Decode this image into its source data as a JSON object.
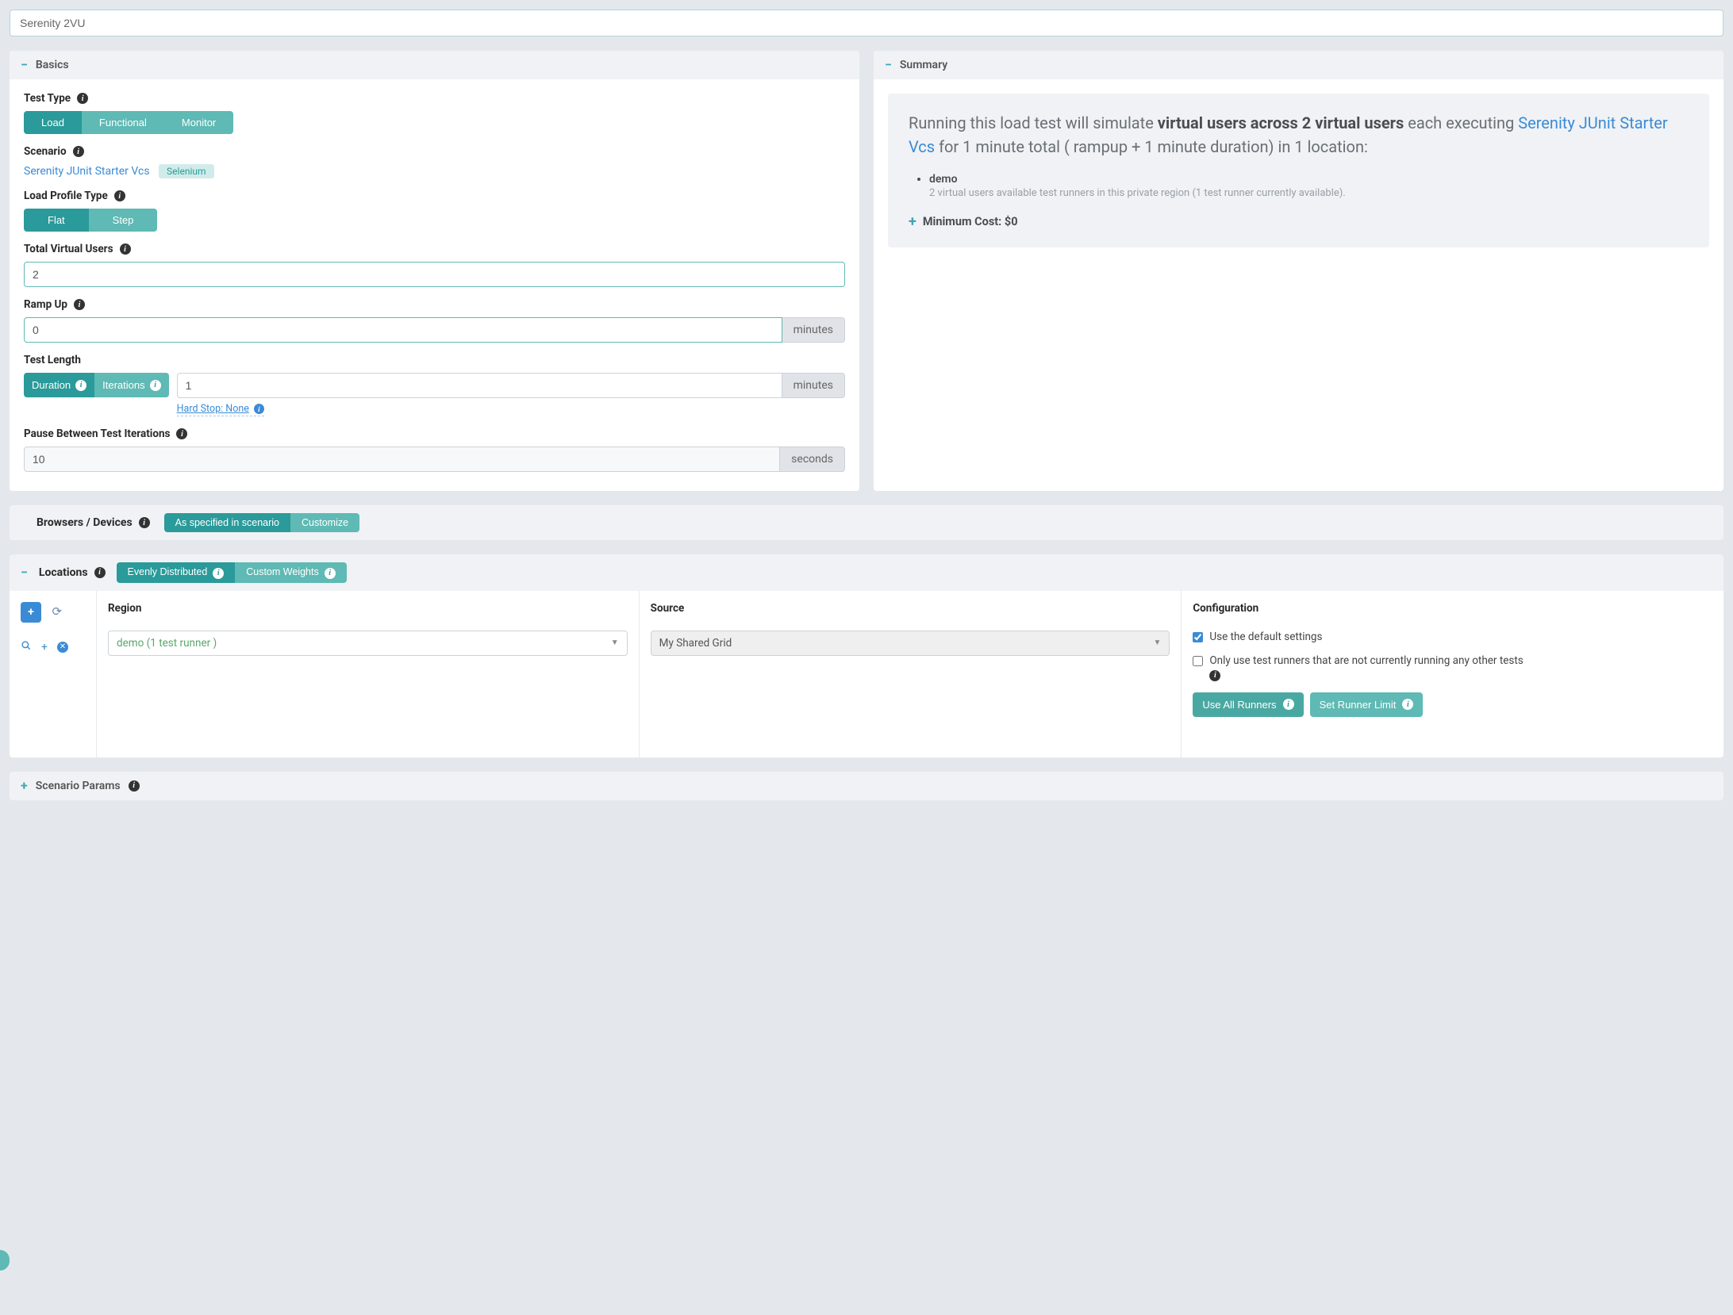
{
  "title_input": "Serenity 2VU",
  "basics": {
    "header": "Basics",
    "test_type": {
      "label": "Test Type",
      "options": {
        "load": "Load",
        "functional": "Functional",
        "monitor": "Monitor"
      }
    },
    "scenario": {
      "label": "Scenario",
      "link": "Serenity JUnit Starter Vcs",
      "badge": "Selenium"
    },
    "load_profile": {
      "label": "Load Profile Type",
      "options": {
        "flat": "Flat",
        "step": "Step"
      }
    },
    "total_vu": {
      "label": "Total Virtual Users",
      "value": "2"
    },
    "ramp_up": {
      "label": "Ramp Up",
      "value": "0",
      "unit": "minutes"
    },
    "test_length": {
      "label": "Test Length",
      "options": {
        "duration": "Duration",
        "iterations": "Iterations"
      },
      "value": "1",
      "unit": "minutes",
      "hard_stop": "Hard Stop: None"
    },
    "pause": {
      "label": "Pause Between Test Iterations",
      "value": "10",
      "unit": "seconds"
    }
  },
  "summary": {
    "header": "Summary",
    "text1": "Running this load test will simulate ",
    "bold1": "virtual users across 2 virtual users",
    "text2": " each executing ",
    "link": "Serenity JUnit Starter Vcs",
    "text3": " for 1 minute total ( rampup + 1 minute duration) in 1 location:",
    "bullet": "demo",
    "sub": "2 virtual users available test runners in this private region (1 test runner currently available).",
    "min_cost": "Minimum Cost: $0"
  },
  "browsers_devices": {
    "label": "Browsers / Devices",
    "options": {
      "as_spec": "As specified in scenario",
      "customize": "Customize"
    }
  },
  "locations": {
    "header": "Locations",
    "dist": {
      "even": "Evenly Distributed",
      "custom": "Custom Weights"
    },
    "cols": {
      "region": "Region",
      "source": "Source",
      "config": "Configuration"
    },
    "row": {
      "region": "demo (1 test runner )",
      "source": "My Shared Grid"
    },
    "config": {
      "default": "Use the default settings",
      "only_idle": "Only use test runners that are not currently running any other tests",
      "use_all": "Use All Runners",
      "set_limit": "Set Runner Limit"
    }
  },
  "scenario_params": {
    "header": "Scenario Params"
  }
}
